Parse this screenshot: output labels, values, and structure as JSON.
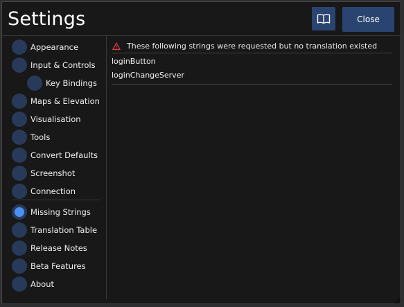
{
  "window": {
    "title": "Settings"
  },
  "header": {
    "docs_icon": "book-icon",
    "close_label": "Close"
  },
  "sidebar": {
    "items": [
      {
        "label": "Appearance",
        "active": false
      },
      {
        "label": "Input & Controls",
        "active": false
      },
      {
        "label": "Key Bindings",
        "active": false
      },
      {
        "label": "Maps & Elevation",
        "active": false
      },
      {
        "label": "Visualisation",
        "active": false
      },
      {
        "label": "Tools",
        "active": false
      },
      {
        "label": "Convert Defaults",
        "active": false
      },
      {
        "label": "Screenshot",
        "active": false
      },
      {
        "label": "Connection",
        "active": false
      },
      {
        "label": "Missing Strings",
        "active": true
      },
      {
        "label": "Translation Table",
        "active": false
      },
      {
        "label": "Release Notes",
        "active": false
      },
      {
        "label": "Beta Features",
        "active": false
      },
      {
        "label": "About",
        "active": false
      }
    ]
  },
  "main": {
    "warning_icon": "warning-icon",
    "warning_text": "These following strings were requested but no translation existed",
    "missing_strings": [
      "loginButton",
      "loginChangeServer"
    ]
  },
  "colors": {
    "background": "#181818",
    "button": "#2a4470",
    "radio": "#283a5a",
    "radio_active": "#4a90f0",
    "warning": "#e04040"
  }
}
